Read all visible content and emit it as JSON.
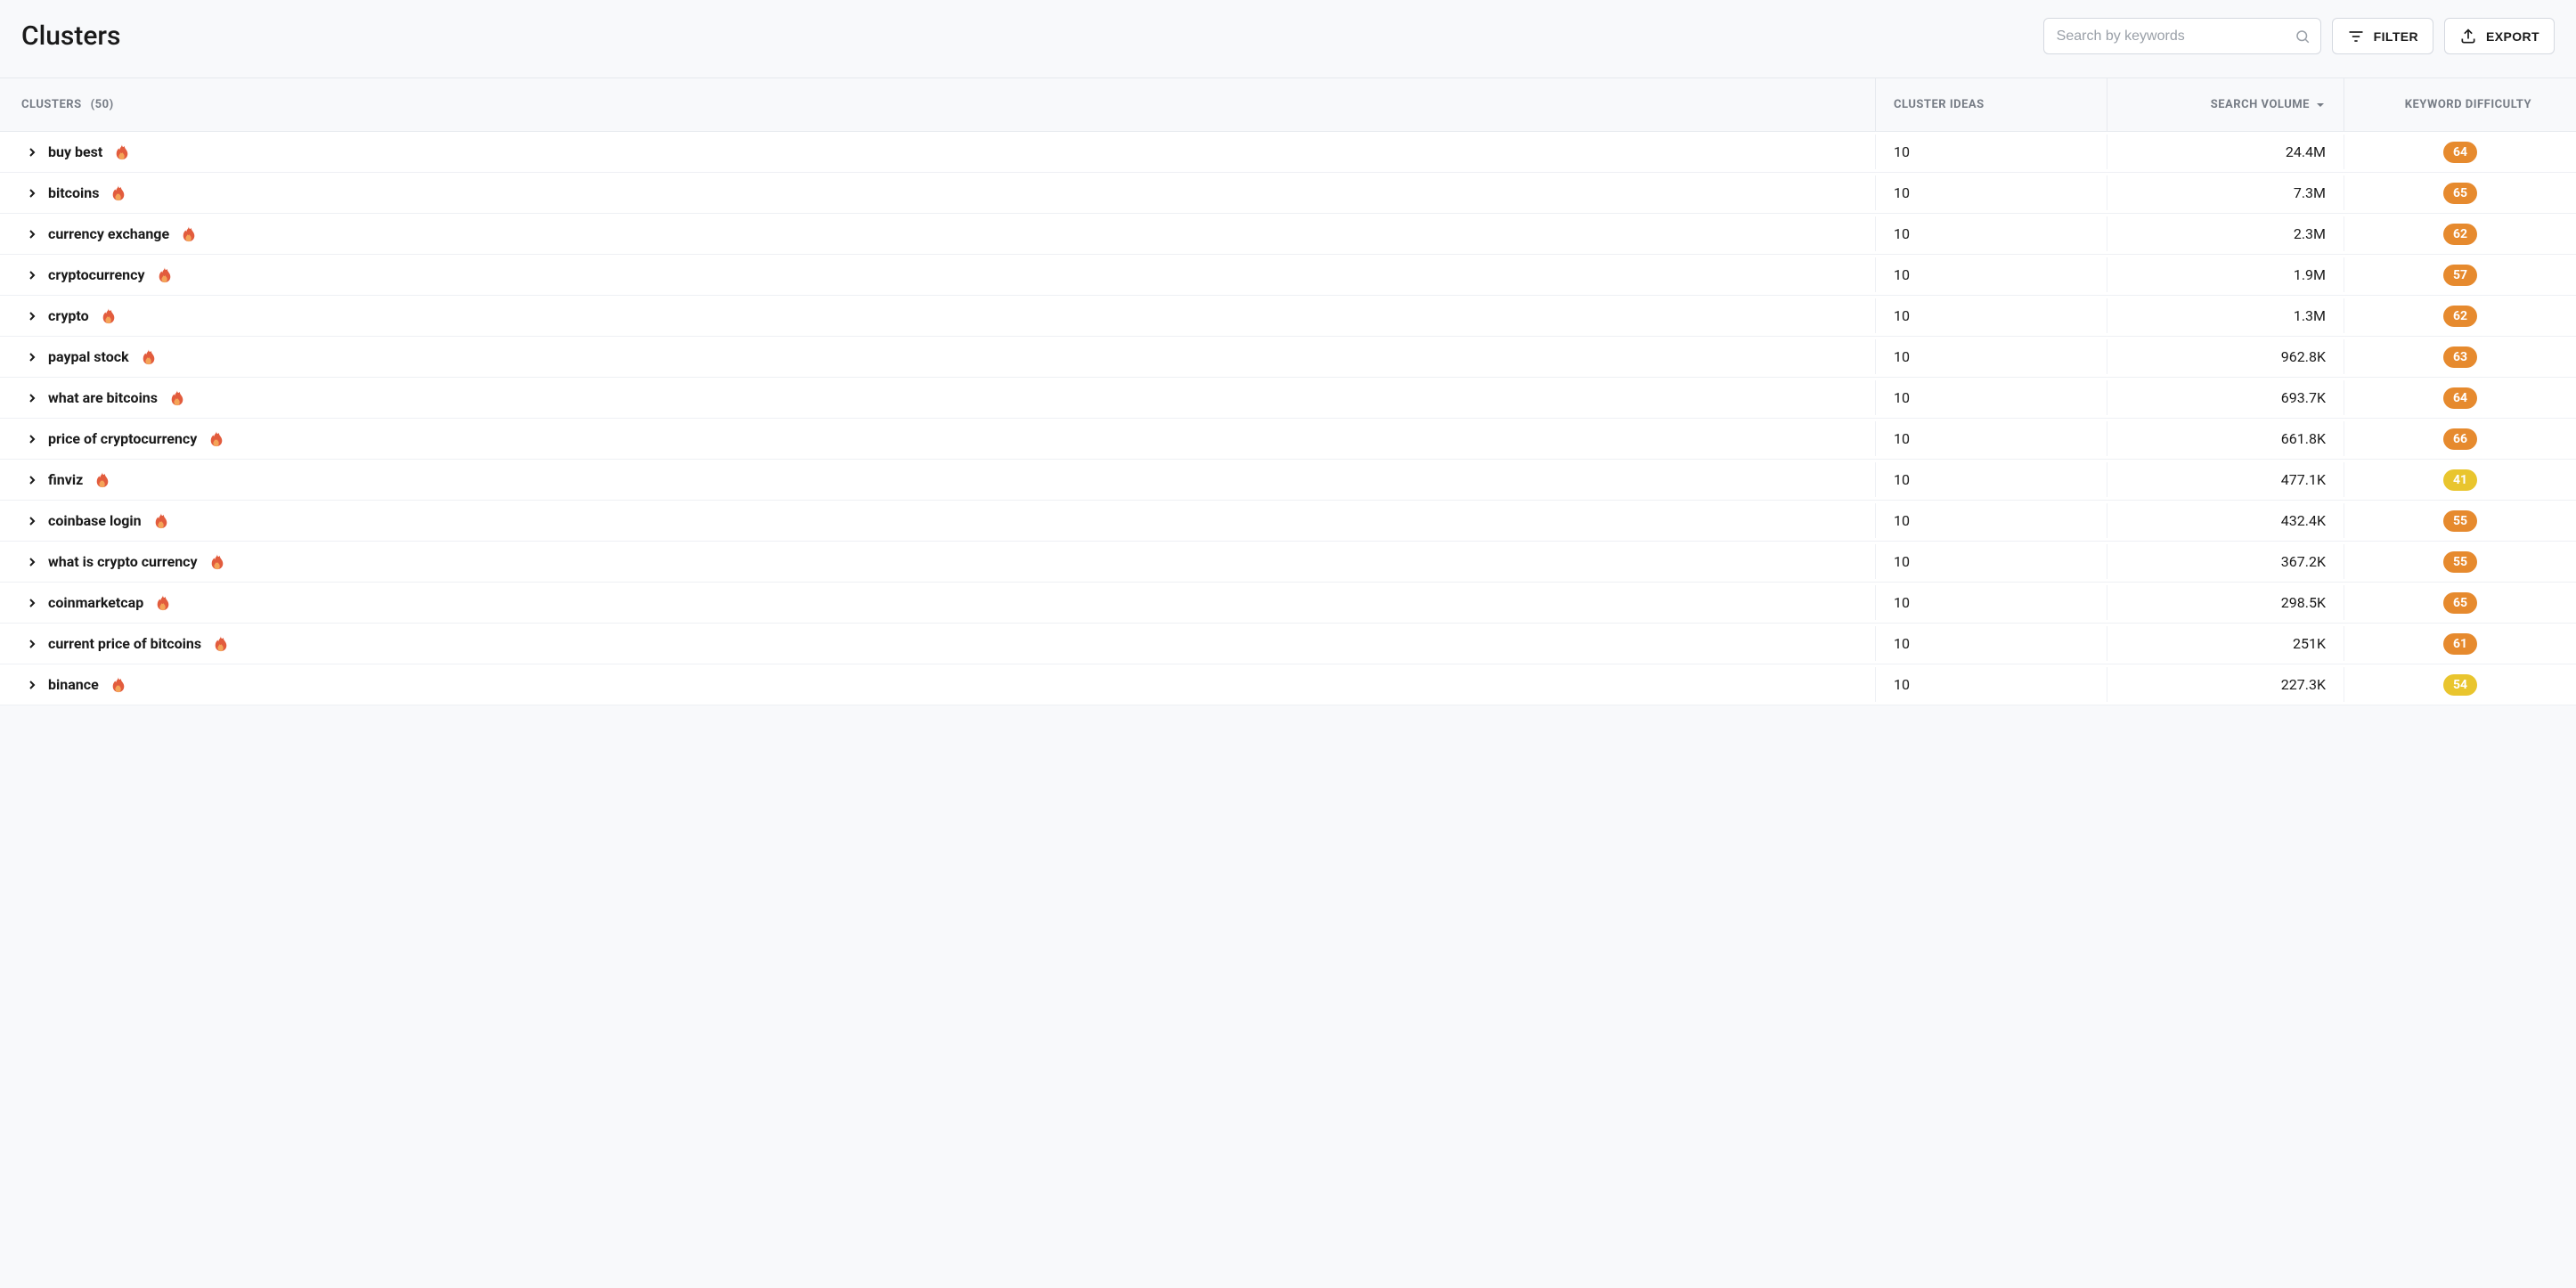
{
  "header": {
    "title": "Clusters",
    "search_placeholder": "Search by keywords",
    "filter_label": "FILTER",
    "export_label": "EXPORT"
  },
  "columns": {
    "clusters_label": "CLUSTERS",
    "clusters_count": "(50)",
    "ideas_label": "CLUSTER IDEAS",
    "volume_label": "SEARCH VOLUME",
    "difficulty_label": "KEYWORD DIFFICULTY"
  },
  "rows": [
    {
      "name": "buy best",
      "ideas": "10",
      "volume": "24.4M",
      "kd": "64",
      "kd_color": "orange"
    },
    {
      "name": "bitcoins",
      "ideas": "10",
      "volume": "7.3M",
      "kd": "65",
      "kd_color": "orange"
    },
    {
      "name": "currency exchange",
      "ideas": "10",
      "volume": "2.3M",
      "kd": "62",
      "kd_color": "orange"
    },
    {
      "name": "cryptocurrency",
      "ideas": "10",
      "volume": "1.9M",
      "kd": "57",
      "kd_color": "orange"
    },
    {
      "name": "crypto",
      "ideas": "10",
      "volume": "1.3M",
      "kd": "62",
      "kd_color": "orange"
    },
    {
      "name": "paypal stock",
      "ideas": "10",
      "volume": "962.8K",
      "kd": "63",
      "kd_color": "orange"
    },
    {
      "name": "what are bitcoins",
      "ideas": "10",
      "volume": "693.7K",
      "kd": "64",
      "kd_color": "orange"
    },
    {
      "name": "price of cryptocurrency",
      "ideas": "10",
      "volume": "661.8K",
      "kd": "66",
      "kd_color": "orange"
    },
    {
      "name": "finviz",
      "ideas": "10",
      "volume": "477.1K",
      "kd": "41",
      "kd_color": "yellow"
    },
    {
      "name": "coinbase login",
      "ideas": "10",
      "volume": "432.4K",
      "kd": "55",
      "kd_color": "orange"
    },
    {
      "name": "what is crypto currency",
      "ideas": "10",
      "volume": "367.2K",
      "kd": "55",
      "kd_color": "orange"
    },
    {
      "name": "coinmarketcap",
      "ideas": "10",
      "volume": "298.5K",
      "kd": "65",
      "kd_color": "orange"
    },
    {
      "name": "current price of bitcoins",
      "ideas": "10",
      "volume": "251K",
      "kd": "61",
      "kd_color": "orange"
    },
    {
      "name": "binance",
      "ideas": "10",
      "volume": "227.3K",
      "kd": "54",
      "kd_color": "yellow"
    }
  ]
}
